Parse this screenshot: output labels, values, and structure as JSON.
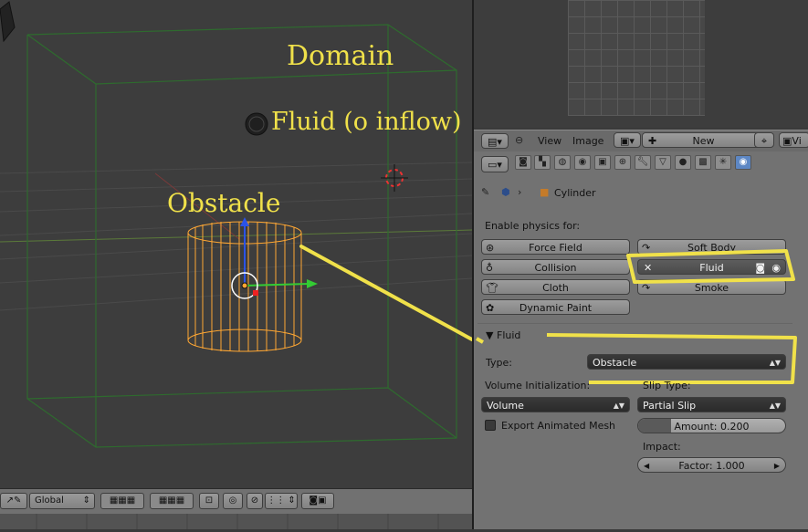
{
  "viewport": {
    "labels": {
      "domain": "Domain",
      "fluid": "Fluid (o inflow)",
      "obstacle": "Obstacle"
    },
    "footer": {
      "orientation": "Global"
    }
  },
  "uv_header": {
    "menu_view": "View",
    "menu_image": "Image",
    "new_button": "New",
    "view_button": "Vi"
  },
  "properties": {
    "breadcrumb_object": "Cylinder",
    "enable_physics_label": "Enable physics for:",
    "physics_buttons": {
      "force_field": "Force Field",
      "collision": "Collision",
      "cloth": "Cloth",
      "dynamic_paint": "Dynamic Paint",
      "soft_body": "Soft Body",
      "fluid": "Fluid",
      "smoke": "Smoke"
    },
    "fluid_panel": {
      "title": "Fluid",
      "type_label": "Type:",
      "type_value": "Obstacle",
      "volume_init_label": "Volume Initialization:",
      "volume_init_value": "Volume",
      "slip_type_label": "Slip Type:",
      "slip_type_value": "Partial Slip",
      "export_mesh_label": "Export Animated Mesh",
      "amount_value": "Amount: 0.200",
      "impact_label": "Impact:",
      "factor_value": "Factor: 1.000"
    }
  },
  "colors": {
    "annotation": "#f0e14a",
    "obstacle_wire": "#ffa733",
    "domain_wire": "#2e6b2e",
    "active_tab": "#5d87c4"
  }
}
